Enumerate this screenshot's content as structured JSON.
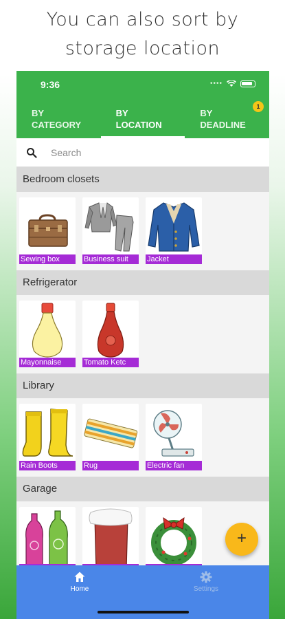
{
  "caption": {
    "line1": "You can also sort by",
    "line2": "storage location"
  },
  "status_bar": {
    "time": "9:36"
  },
  "tabs": [
    {
      "line1": "BY",
      "line2": "CATEGORY"
    },
    {
      "line1": "BY",
      "line2": "LOCATION",
      "active": true
    },
    {
      "line1": "BY",
      "line2": "DEADLINE",
      "badge": "1"
    }
  ],
  "search": {
    "placeholder": "Search"
  },
  "sections": [
    {
      "title": "Bedroom closets",
      "items": [
        {
          "label": "Sewing box",
          "icon": "toolbox-icon"
        },
        {
          "label": "Business suit",
          "icon": "suit-icon"
        },
        {
          "label": "Jacket",
          "icon": "jacket-icon"
        }
      ]
    },
    {
      "title": "Refrigerator",
      "items": [
        {
          "label": "Mayonnaise",
          "icon": "mayonnaise-bottle-icon"
        },
        {
          "label": "Tomato  Ketc",
          "icon": "ketchup-bottle-icon"
        }
      ]
    },
    {
      "title": "Library",
      "items": [
        {
          "label": "Rain Boots",
          "icon": "rain-boots-icon"
        },
        {
          "label": "Rug",
          "icon": "rug-icon"
        },
        {
          "label": "Electric fan",
          "icon": "electric-fan-icon"
        }
      ]
    },
    {
      "title": "Garage",
      "items": [
        {
          "label": "",
          "icon": "bottles-icon"
        },
        {
          "label": "",
          "icon": "stocking-icon"
        },
        {
          "label": "",
          "icon": "wreath-icon"
        }
      ]
    }
  ],
  "fab": {
    "label": "+"
  },
  "bottom_nav": [
    {
      "label": "Home",
      "icon": "home-icon",
      "active": true
    },
    {
      "label": "Settings",
      "icon": "gear-icon",
      "active": false
    }
  ],
  "colors": {
    "app_bar": "#3bb24b",
    "item_label": "#a52bd6",
    "fab": "#f9b81a",
    "bottom_nav": "#4a86e8"
  }
}
